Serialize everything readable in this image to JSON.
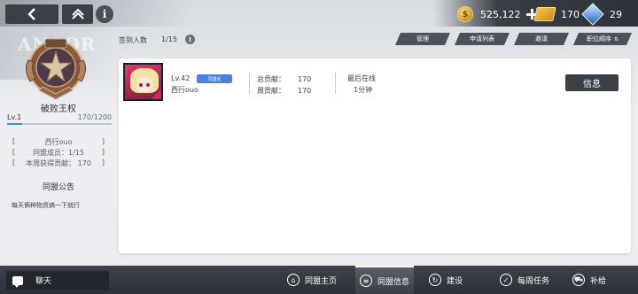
{
  "nav": {
    "back_icon": "chevron-left-icon",
    "home_icon": "double-chevron-up-icon",
    "info_icon": "info-icon",
    "info_label": "i"
  },
  "currencies": [
    {
      "icon": "gold-coin-icon",
      "value": "525,122"
    },
    {
      "icon": "gold-ticket-icon",
      "value": "170"
    },
    {
      "icon": "blue-gem-icon",
      "value": "29"
    }
  ],
  "banner_text": "ANAOR",
  "guild": {
    "title": "破败王权",
    "level_label": "Lv.1",
    "xp": "170/1200",
    "xp_fraction": 0.1417,
    "leader": "西行ouo",
    "members": "同盟成员：1/15",
    "weekly": "本周获得贡献：  170",
    "notice_title": "同盟公告",
    "notice_text": "每天俩种物资搞一下就行"
  },
  "roster": {
    "counter_label": "签到人数",
    "counter_value": "1/15",
    "counter_info": "i",
    "actions": [
      "管理",
      "申请列表",
      "邀请",
      "职位顺序"
    ],
    "sort_arrows": "⇅"
  },
  "member": {
    "level": "Lv.42",
    "role_badge": "同盟长",
    "name": "西行ouo",
    "total_label": "总贡献：",
    "total_value": "170",
    "weekly_label": "周贡献：",
    "weekly_value": "170",
    "online_label": "最后在线",
    "online_value": "1分钟",
    "info_button": "信息"
  },
  "bottom": {
    "chat_label": "聊天",
    "tabs": [
      {
        "label": "同盟主页",
        "icon": "home-icon",
        "glyph": "⌂"
      },
      {
        "label": "同盟信息",
        "icon": "list-icon",
        "glyph": "≡"
      },
      {
        "label": "建设",
        "icon": "build-icon",
        "glyph": "↻"
      },
      {
        "label": "每周任务",
        "icon": "task-icon",
        "glyph": "✓"
      },
      {
        "label": "补给",
        "icon": "cart-icon",
        "glyph": "⛟"
      }
    ]
  },
  "colors": {
    "accent_blue": "#3b8be0",
    "dark_button": "#3b3f48",
    "role_badge": "#4d7fd8"
  }
}
